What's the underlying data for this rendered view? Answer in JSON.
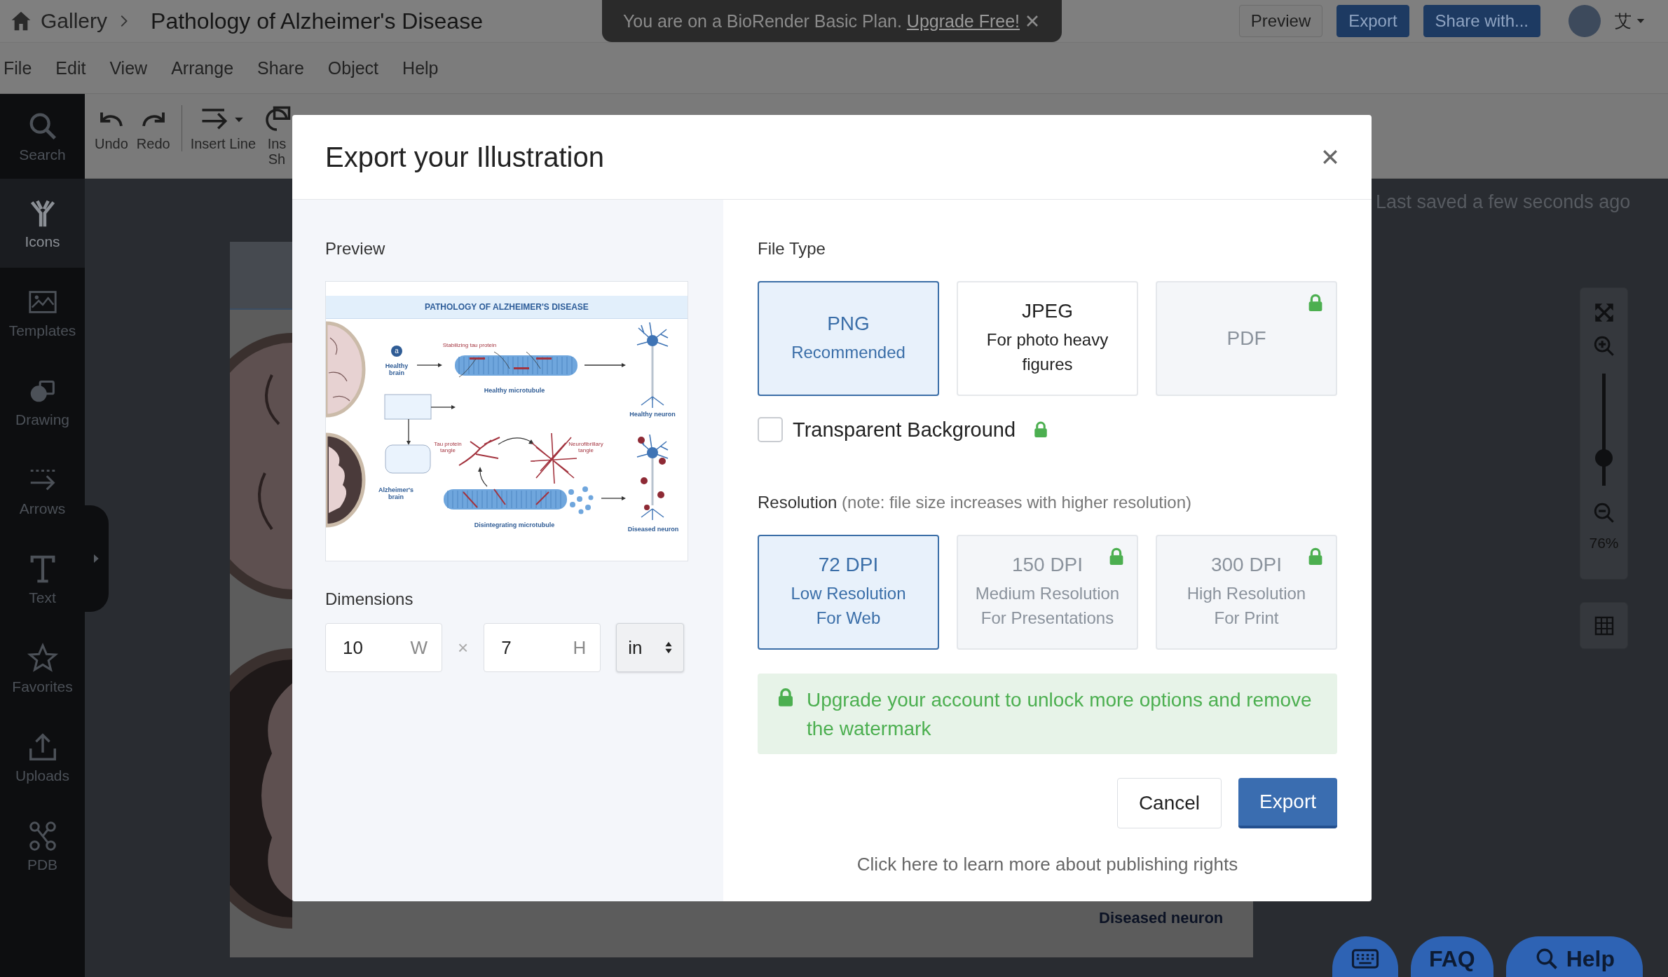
{
  "top_bar": {
    "breadcrumb": "Gallery",
    "title": "Pathology of Alzheimer's Disease",
    "notice": {
      "text": "You are on a BioRender Basic Plan.",
      "link": "Upgrade Free!"
    },
    "buttons": [
      {
        "label": "Preview",
        "kind": "outline"
      },
      {
        "label": "Export",
        "kind": "primary"
      },
      {
        "label": "Share with...",
        "kind": "primary"
      }
    ],
    "user": "艾"
  },
  "menu": [
    "File",
    "Edit",
    "View",
    "Arrange",
    "Share",
    "Object",
    "Help"
  ],
  "sidebar": [
    {
      "label": "Search",
      "selected": false
    },
    {
      "label": "Icons",
      "selected": true
    },
    {
      "label": "Templates",
      "selected": false
    },
    {
      "label": "Drawing",
      "selected": false
    },
    {
      "label": "Arrows",
      "selected": false
    },
    {
      "label": "Text",
      "selected": false
    },
    {
      "label": "Favorites",
      "selected": false
    },
    {
      "label": "Uploads",
      "selected": false
    },
    {
      "label": "PDB",
      "selected": false
    }
  ],
  "toolbar": [
    {
      "label": "Undo",
      "dropdown": false,
      "separated": false
    },
    {
      "label": "Redo",
      "dropdown": false,
      "separated": false
    },
    {
      "label": "Insert Line",
      "dropdown": true,
      "separated": true
    },
    {
      "label": "Ins Sh",
      "dropdown": false,
      "separated": false
    }
  ],
  "canvas": {
    "status": "Last saved a few seconds ago",
    "page_texts": [
      "Diseased neuron"
    ],
    "zoom_label": "76%",
    "zoom_slider": {
      "level": 0.2
    }
  },
  "help_buttons": [
    {
      "kind": "keyboard"
    },
    {
      "kind": "text",
      "label": "FAQ"
    },
    {
      "kind": "search",
      "label": "Help"
    }
  ],
  "dialog": {
    "title": "Export your Illustration",
    "preview_label": "Preview",
    "preview": {
      "title": "PATHOLOGY OF ALZHEIMER'S DISEASE",
      "labels": [
        {
          "text": "a",
          "kind": "marker"
        },
        {
          "text": "Healthy brain",
          "kind": "caption"
        },
        {
          "text": "Stabilizing tau protein",
          "kind": "protein"
        },
        {
          "text": "Healthy microtubule",
          "kind": "caption"
        },
        {
          "text": "Healthy neuron",
          "kind": "caption"
        },
        {
          "text": "Tau protein tangle",
          "kind": "protein"
        },
        {
          "text": "Neurofibrillary tangle",
          "kind": "protein"
        },
        {
          "text": "Alzheimer's brain",
          "kind": "caption"
        },
        {
          "text": "Disintegrating microtubule",
          "kind": "caption"
        },
        {
          "text": "Diseased neuron",
          "kind": "caption"
        }
      ]
    },
    "dimensions_label": "Dimensions",
    "width": {
      "value": "10",
      "suffix": "W"
    },
    "separator": "×",
    "height": {
      "value": "7",
      "suffix": "H"
    },
    "unit": "in",
    "file_type_label": "File Type",
    "file_types": [
      {
        "title": "PNG",
        "subtitle": "Recommended",
        "selected": true,
        "locked": false
      },
      {
        "title": "JPEG",
        "subtitle": "For photo heavy figures",
        "selected": false,
        "locked": false
      },
      {
        "title": "PDF",
        "selected": false,
        "locked": true
      }
    ],
    "transparent_background": {
      "label": "Transparent Background",
      "checked": false,
      "locked": true
    },
    "resolution_label": "**Resolution** (note: file size increases with higher resolution)",
    "resolutions": [
      {
        "title": "72 DPI",
        "description": "Low Resolution",
        "purpose": "For Web",
        "selected": true,
        "locked": false
      },
      {
        "title": "150 DPI",
        "description": "Medium Resolution",
        "purpose": "For Presentations",
        "selected": false,
        "locked": true
      },
      {
        "title": "300 DPI",
        "description": "High Resolution",
        "purpose": "For Print",
        "selected": false,
        "locked": true
      }
    ],
    "upgrade_notice": "Upgrade your account to unlock more options and remove the watermark",
    "buttons": [
      {
        "label": "Cancel",
        "kind": "secondary"
      },
      {
        "label": "Export",
        "kind": "primary"
      }
    ],
    "rights_link": "Click here to learn more about publishing rights"
  }
}
